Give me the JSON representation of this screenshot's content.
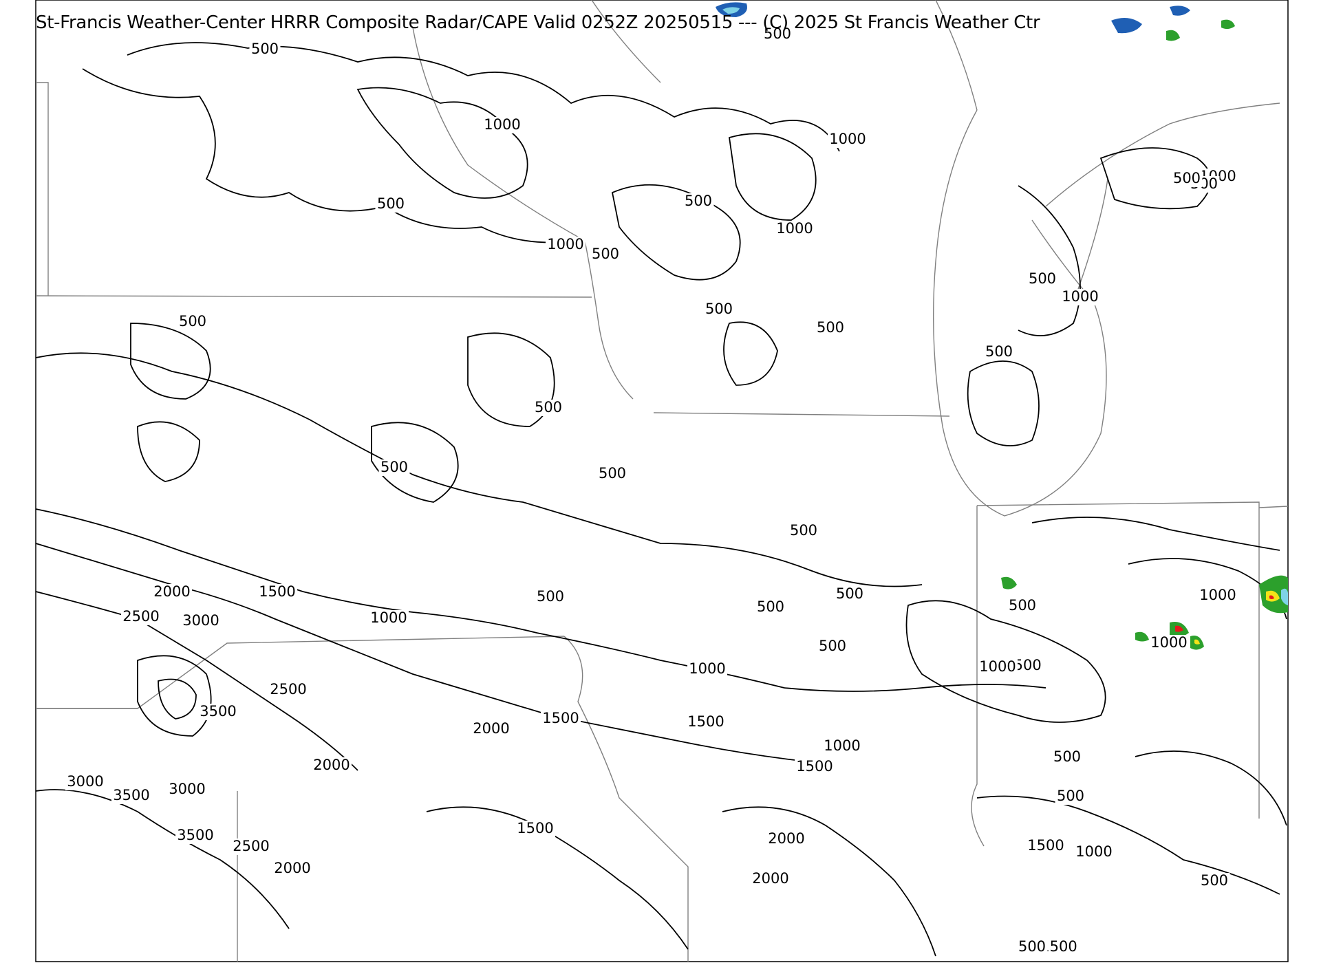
{
  "title": "St-Francis Weather-Center HRRR Composite Radar/CAPE  Valid  0252Z 20250515  --- (C) 2025 St Francis Weather Ctr",
  "colors": {
    "background": "#ffffff",
    "contour": "#000000",
    "boundary": "#808080",
    "radar_light": "#2ca02c",
    "radar_blue": "#1f5fb4",
    "radar_cyan": "#7fd3e6",
    "radar_yellow": "#f2e318",
    "radar_red": "#e31a1c"
  },
  "contour_labels": [
    {
      "id": "cl-1",
      "text": "500"
    },
    {
      "id": "cl-2",
      "text": "500"
    },
    {
      "id": "cl-3",
      "text": "1000"
    },
    {
      "id": "cl-4",
      "text": "1000"
    },
    {
      "id": "cl-5",
      "text": "500"
    },
    {
      "id": "cl-6",
      "text": "500"
    },
    {
      "id": "cl-7",
      "text": "1000"
    },
    {
      "id": "cl-8",
      "text": "1000"
    },
    {
      "id": "cl-9",
      "text": "500"
    },
    {
      "id": "cl-10",
      "text": "1000"
    },
    {
      "id": "cl-11",
      "text": "500"
    },
    {
      "id": "cl-12",
      "text": "500"
    },
    {
      "id": "cl-13",
      "text": "1000"
    },
    {
      "id": "cl-14",
      "text": "500"
    },
    {
      "id": "cl-15",
      "text": "500"
    },
    {
      "id": "cl-16",
      "text": "500"
    },
    {
      "id": "cl-17",
      "text": "500"
    },
    {
      "id": "cl-18",
      "text": "500"
    },
    {
      "id": "cl-19",
      "text": "500"
    },
    {
      "id": "cl-20",
      "text": "500"
    },
    {
      "id": "cl-21",
      "text": "500"
    },
    {
      "id": "cl-22",
      "text": "500"
    },
    {
      "id": "cl-23",
      "text": "500"
    },
    {
      "id": "cl-24",
      "text": "500"
    },
    {
      "id": "cl-25",
      "text": "500"
    },
    {
      "id": "cl-26",
      "text": "500"
    },
    {
      "id": "cl-27",
      "text": "1000"
    },
    {
      "id": "cl-28",
      "text": "2000"
    },
    {
      "id": "cl-29",
      "text": "1500"
    },
    {
      "id": "cl-30",
      "text": "2500"
    },
    {
      "id": "cl-31",
      "text": "3000"
    },
    {
      "id": "cl-32",
      "text": "1000"
    },
    {
      "id": "cl-33",
      "text": "500"
    },
    {
      "id": "cl-34",
      "text": "1000"
    },
    {
      "id": "cl-35",
      "text": "1500"
    },
    {
      "id": "cl-36",
      "text": "1000"
    },
    {
      "id": "cl-37",
      "text": "1000"
    },
    {
      "id": "cl-38",
      "text": "2500"
    },
    {
      "id": "cl-39",
      "text": "3500"
    },
    {
      "id": "cl-40",
      "text": "2000"
    },
    {
      "id": "cl-41",
      "text": "1500"
    },
    {
      "id": "cl-42",
      "text": "1500"
    },
    {
      "id": "cl-43",
      "text": "1000"
    },
    {
      "id": "cl-44",
      "text": "1500"
    },
    {
      "id": "cl-45",
      "text": "2000"
    },
    {
      "id": "cl-46",
      "text": "3000"
    },
    {
      "id": "cl-47",
      "text": "3500"
    },
    {
      "id": "cl-48",
      "text": "3000"
    },
    {
      "id": "cl-49",
      "text": "500"
    },
    {
      "id": "cl-50",
      "text": "500"
    },
    {
      "id": "cl-51",
      "text": "3500"
    },
    {
      "id": "cl-52",
      "text": "2500"
    },
    {
      "id": "cl-53",
      "text": "2000"
    },
    {
      "id": "cl-54",
      "text": "1500"
    },
    {
      "id": "cl-55",
      "text": "2000"
    },
    {
      "id": "cl-56",
      "text": "2000"
    },
    {
      "id": "cl-57",
      "text": "1500"
    },
    {
      "id": "cl-58",
      "text": "1000"
    },
    {
      "id": "cl-59",
      "text": "500"
    },
    {
      "id": "cl-60",
      "text": "1500"
    },
    {
      "id": "cl-61",
      "text": "500"
    }
  ]
}
